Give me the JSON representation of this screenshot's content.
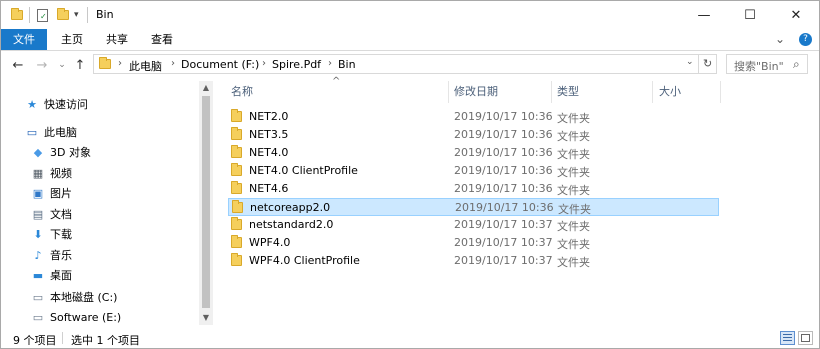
{
  "window": {
    "title": "Bin",
    "controls": {
      "minimize": "—",
      "maximize": "☐",
      "close": "✕"
    }
  },
  "ribbon": {
    "tabs": [
      {
        "label": "文件"
      },
      {
        "label": "主页"
      },
      {
        "label": "共享"
      },
      {
        "label": "查看"
      }
    ],
    "expand_glyph": "⌄",
    "help_glyph": "?"
  },
  "nav": {
    "back": "←",
    "forward": "→",
    "recent": "⌄",
    "up": "↑",
    "breadcrumbs": [
      "此电脑",
      "Document (F:)",
      "Spire.Pdf",
      "Bin"
    ],
    "crumb_sep": "›",
    "refresh": "↻",
    "search_placeholder": "搜索\"Bin\"",
    "search_glyph": "⌕"
  },
  "sidebar": {
    "items": [
      {
        "label": "快速访问",
        "icon": "star-icon",
        "glyph": "★",
        "color": "#2b88d8"
      },
      {
        "label": "此电脑",
        "icon": "computer-icon",
        "glyph": "▭",
        "color": "#1e5fb4"
      },
      {
        "label": "3D 对象",
        "icon": "cube-icon",
        "glyph": "◆",
        "color": "#4a9ae6"
      },
      {
        "label": "视频",
        "icon": "video-icon",
        "glyph": "▦",
        "color": "#505a64"
      },
      {
        "label": "图片",
        "icon": "picture-icon",
        "glyph": "▣",
        "color": "#2f78c8"
      },
      {
        "label": "文档",
        "icon": "document-icon",
        "glyph": "▤",
        "color": "#5a6e84"
      },
      {
        "label": "下载",
        "icon": "download-icon",
        "glyph": "⬇",
        "color": "#2b88d8"
      },
      {
        "label": "音乐",
        "icon": "music-icon",
        "glyph": "♪",
        "color": "#2b88d8"
      },
      {
        "label": "桌面",
        "icon": "desktop-icon",
        "glyph": "▬",
        "color": "#2b88d8"
      },
      {
        "label": "本地磁盘 (C:)",
        "icon": "drive-icon",
        "glyph": "▭",
        "color": "#6b7a8c"
      },
      {
        "label": "Software (E:)",
        "icon": "drive-icon",
        "glyph": "▭",
        "color": "#6b7a8c"
      }
    ]
  },
  "columns": {
    "name": "名称",
    "date": "修改日期",
    "type": "类型",
    "size": "大小",
    "sort_glyph": "^"
  },
  "files": [
    {
      "name": "NET2.0",
      "date": "2019/10/17 10:36",
      "type": "文件夹"
    },
    {
      "name": "NET3.5",
      "date": "2019/10/17 10:36",
      "type": "文件夹"
    },
    {
      "name": "NET4.0",
      "date": "2019/10/17 10:36",
      "type": "文件夹"
    },
    {
      "name": "NET4.0 ClientProfile",
      "date": "2019/10/17 10:36",
      "type": "文件夹"
    },
    {
      "name": "NET4.6",
      "date": "2019/10/17 10:36",
      "type": "文件夹"
    },
    {
      "name": "netcoreapp2.0",
      "date": "2019/10/17 10:36",
      "type": "文件夹",
      "selected": true
    },
    {
      "name": "netstandard2.0",
      "date": "2019/10/17 10:37",
      "type": "文件夹"
    },
    {
      "name": "WPF4.0",
      "date": "2019/10/17 10:37",
      "type": "文件夹"
    },
    {
      "name": "WPF4.0 ClientProfile",
      "date": "2019/10/17 10:37",
      "type": "文件夹"
    }
  ],
  "status": {
    "count": "9 个项目",
    "selected": "选中 1 个项目"
  },
  "colors": {
    "accent": "#1979ca",
    "selection": "#cce8ff",
    "folder": "#f5cf5c"
  }
}
